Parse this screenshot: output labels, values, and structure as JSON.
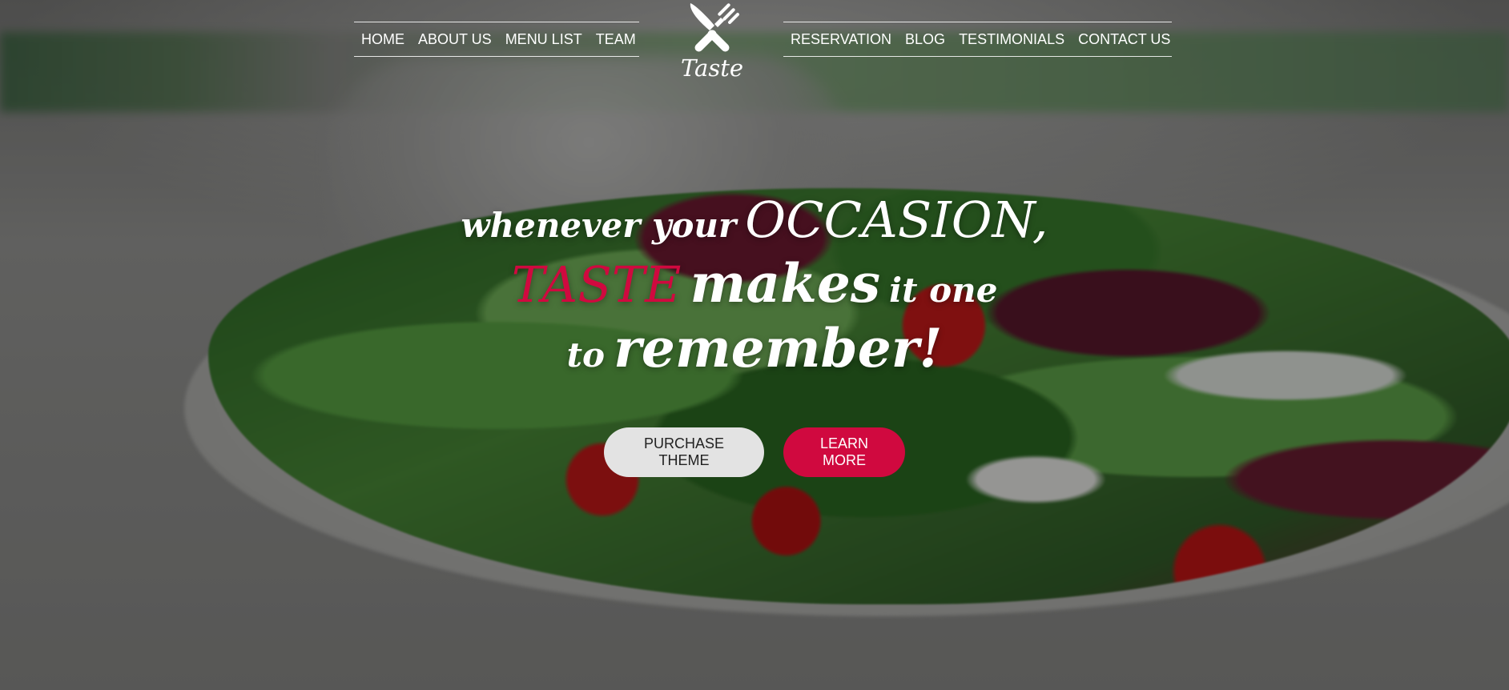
{
  "nav": {
    "left_links": [
      {
        "label": "HOME"
      },
      {
        "label": "ABOUT US"
      },
      {
        "label": "MENU LIST"
      },
      {
        "label": "TEAM"
      }
    ],
    "right_links": [
      {
        "label": "RESERVATION"
      },
      {
        "label": "BLOG"
      },
      {
        "label": "TESTIMONIALS"
      },
      {
        "label": "CONTACT US"
      }
    ]
  },
  "logo": {
    "text": "Taste",
    "icon": "crossed-knife-fork-icon"
  },
  "hero": {
    "line1_small": "whenever your",
    "line1_large": "OCCASION,",
    "line2_accent": "TASTE",
    "line2_large": "makes",
    "line2_small": "it one",
    "line3_small": "to",
    "line3_large": "remember!"
  },
  "buttons": {
    "purchase": "PURCHASE THEME",
    "learn_more": "LEARN MORE"
  },
  "colors": {
    "accent": "#d0093f",
    "light_button": "#e3e3e3",
    "text": "#ffffff"
  },
  "background": {
    "image": "salad-bowl-photo"
  }
}
